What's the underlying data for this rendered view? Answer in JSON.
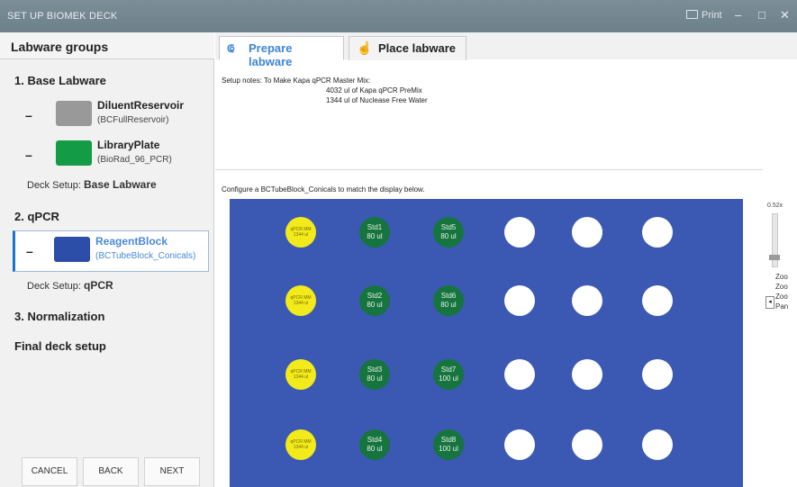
{
  "titlebar": {
    "title": "SET UP BIOMEK DECK",
    "print_label": "Print",
    "minimize": "–",
    "maximize": "□",
    "close": "✕"
  },
  "left": {
    "header": "Labware groups",
    "sections": [
      {
        "label": "1. Base Labware"
      },
      {
        "label": "2. qPCR"
      },
      {
        "label": "3. Normalization"
      },
      {
        "label": "Final deck setup"
      }
    ],
    "items": [
      {
        "dash": "–",
        "name": "DiluentReservoir",
        "sub": "(BCFullReservoir)",
        "color": "#999999"
      },
      {
        "dash": "–",
        "name": "LibraryPlate",
        "sub": "(BioRad_96_PCR)",
        "color": "#139c45"
      },
      {
        "dash": "–",
        "name": "ReagentBlock",
        "sub": "(BCTubeBlock_Conicals)",
        "color": "#2d4ea8"
      }
    ],
    "deck_setup_prefix": "Deck Setup:",
    "deck_setup_1": "Base Labware",
    "deck_setup_2": "qPCR",
    "buttons": {
      "cancel": "CANCEL",
      "back": "BACK",
      "next": "NEXT"
    }
  },
  "tabs": [
    {
      "label": "Prepare labware",
      "active": true
    },
    {
      "label": "Place labware",
      "active": false
    }
  ],
  "notes": {
    "label": "Setup notes:",
    "line1": "To Make Kapa qPCR Master Mix:",
    "line2": "4032 ul of Kapa qPCR PreMix",
    "line3": "1344 ul of Nuclease Free Water"
  },
  "configure_text": "Configure a BCTubeBlock_Conicals to match the display below.",
  "deck": {
    "color": "#3b59b2",
    "wells": [
      [
        {
          "t": "yellow",
          "l1": "qPCR MM",
          "l2": "1344 ul"
        },
        {
          "t": "green",
          "l1": "Std1",
          "l2": "80 ul"
        },
        {
          "t": "green",
          "l1": "Std5",
          "l2": "80 ul"
        },
        {
          "t": "white"
        },
        {
          "t": "white"
        },
        {
          "t": "white"
        }
      ],
      [
        {
          "t": "yellow",
          "l1": "qPCR MM",
          "l2": "1344 ul"
        },
        {
          "t": "green",
          "l1": "Std2",
          "l2": "80 ul"
        },
        {
          "t": "green",
          "l1": "Std6",
          "l2": "80 ul"
        },
        {
          "t": "white"
        },
        {
          "t": "white"
        },
        {
          "t": "white"
        }
      ],
      [
        {
          "t": "yellow",
          "l1": "qPCR MM",
          "l2": "1344 ul"
        },
        {
          "t": "green",
          "l1": "Std3",
          "l2": "80 ul"
        },
        {
          "t": "green",
          "l1": "Std7",
          "l2": "100 ul"
        },
        {
          "t": "white"
        },
        {
          "t": "white"
        },
        {
          "t": "white"
        }
      ],
      [
        {
          "t": "yellow",
          "l1": "qPCR MM",
          "l2": "1344 ul"
        },
        {
          "t": "green",
          "l1": "Std4",
          "l2": "80 ul"
        },
        {
          "t": "green",
          "l1": "Std8",
          "l2": "100 ul"
        },
        {
          "t": "white"
        },
        {
          "t": "white"
        },
        {
          "t": "white"
        }
      ]
    ]
  },
  "zoom": {
    "level": "0.52x",
    "options": [
      "Zoo",
      "Zoo",
      "Zoo",
      "Pan"
    ]
  }
}
